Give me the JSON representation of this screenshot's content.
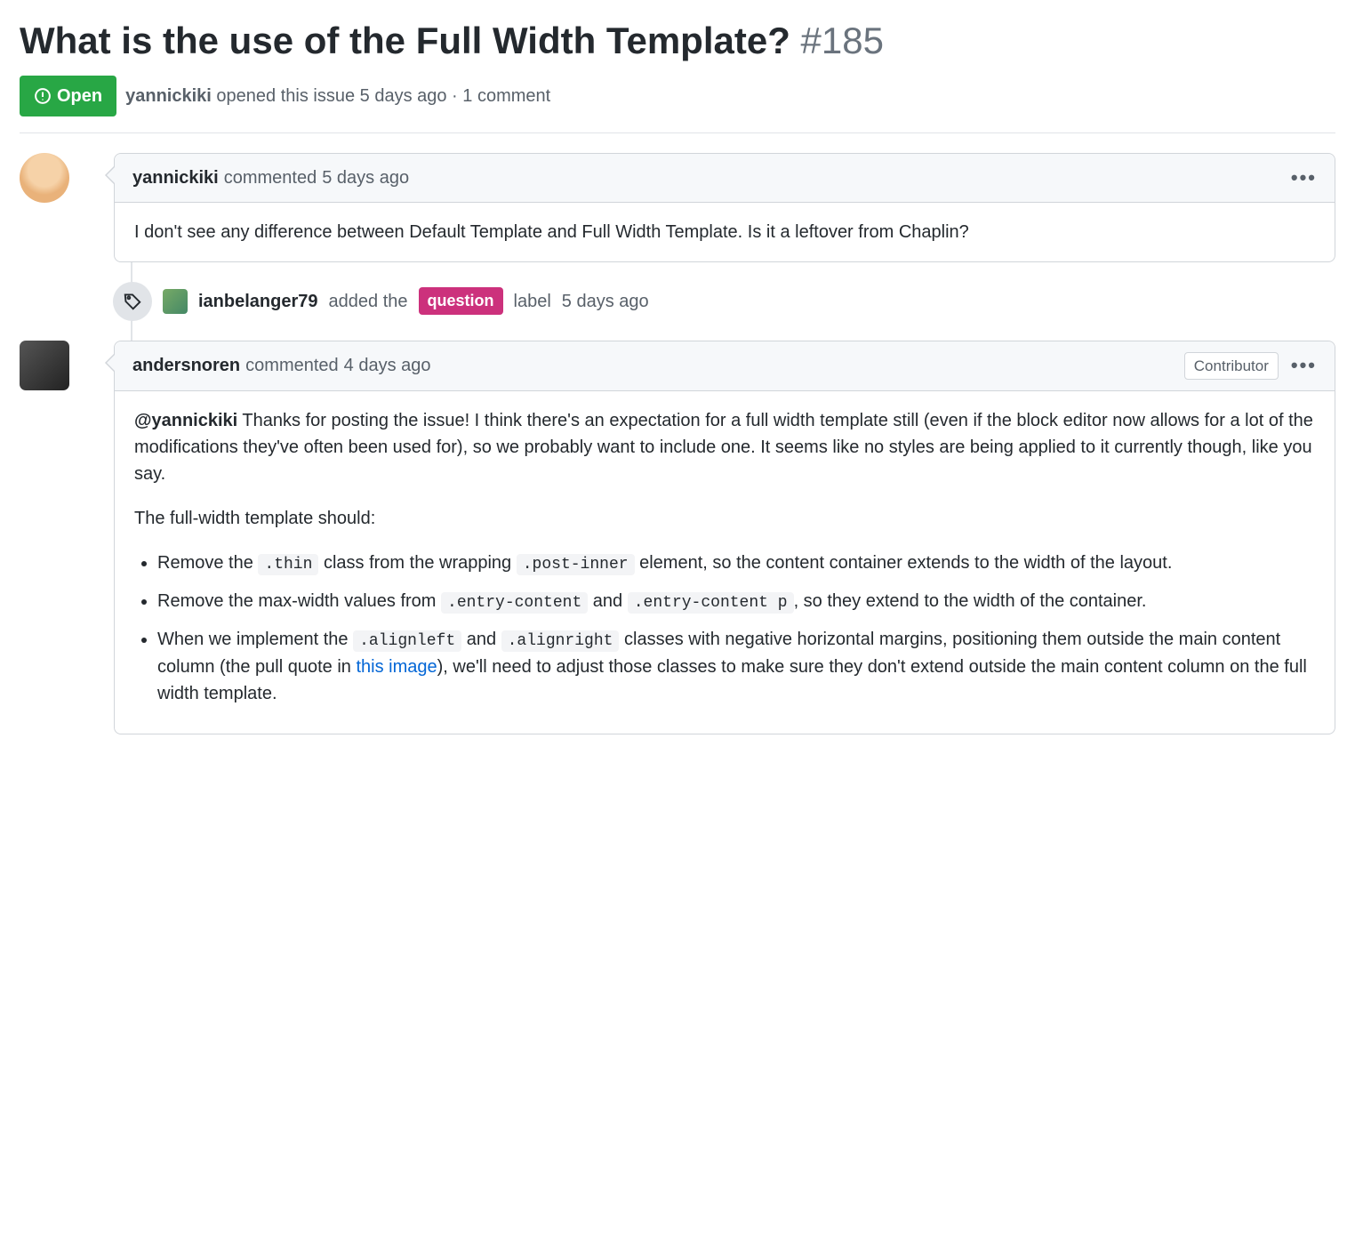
{
  "issue": {
    "title": "What is the use of the Full Width Template?",
    "number": "#185",
    "state": "Open",
    "opener": "yannickiki",
    "opened_verb": "opened this issue",
    "opened_when": "5 days ago",
    "comment_count_text": "1 comment"
  },
  "comments": [
    {
      "author": "yannickiki",
      "verb": "commented",
      "when": "5 days ago",
      "role": null,
      "body_plain": "I don't see any difference between Default Template and Full Width Template. Is it a leftover from Chaplin?"
    },
    {
      "author": "andersnoren",
      "verb": "commented",
      "when": "4 days ago",
      "role": "Contributor",
      "body": {
        "mention": "@yannickiki",
        "p1_rest": " Thanks for posting the issue! I think there's an expectation for a full width template still (even if the block editor now allows for a lot of the modifications they've often been used for), so we probably want to include one. It seems like no styles are being applied to it currently though, like you say.",
        "p2": "The full-width template should:",
        "li1_a": "Remove the ",
        "li1_code1": ".thin",
        "li1_b": " class from the wrapping ",
        "li1_code2": ".post-inner",
        "li1_c": " element, so the content container extends to the width of the layout.",
        "li2_a": "Remove the max-width values from ",
        "li2_code1": ".entry-content",
        "li2_b": " and ",
        "li2_code2": ".entry-content p",
        "li2_c": ", so they extend to the width of the container.",
        "li3_a": "When we implement the ",
        "li3_code1": ".alignleft",
        "li3_b": " and ",
        "li3_code2": ".alignright",
        "li3_c": " classes with negative horizontal margins, positioning them outside the main content column (the pull quote in ",
        "li3_link": "this image",
        "li3_d": "), we'll need to adjust those classes to make sure they don't extend outside the main content column on the full width template."
      }
    }
  ],
  "event": {
    "author": "ianbelanger79",
    "verb": "added the",
    "label": "question",
    "suffix": "label",
    "when": "5 days ago"
  },
  "colors": {
    "state_open": "#28a745",
    "label_question": "#cc317c",
    "link": "#0366d6"
  }
}
